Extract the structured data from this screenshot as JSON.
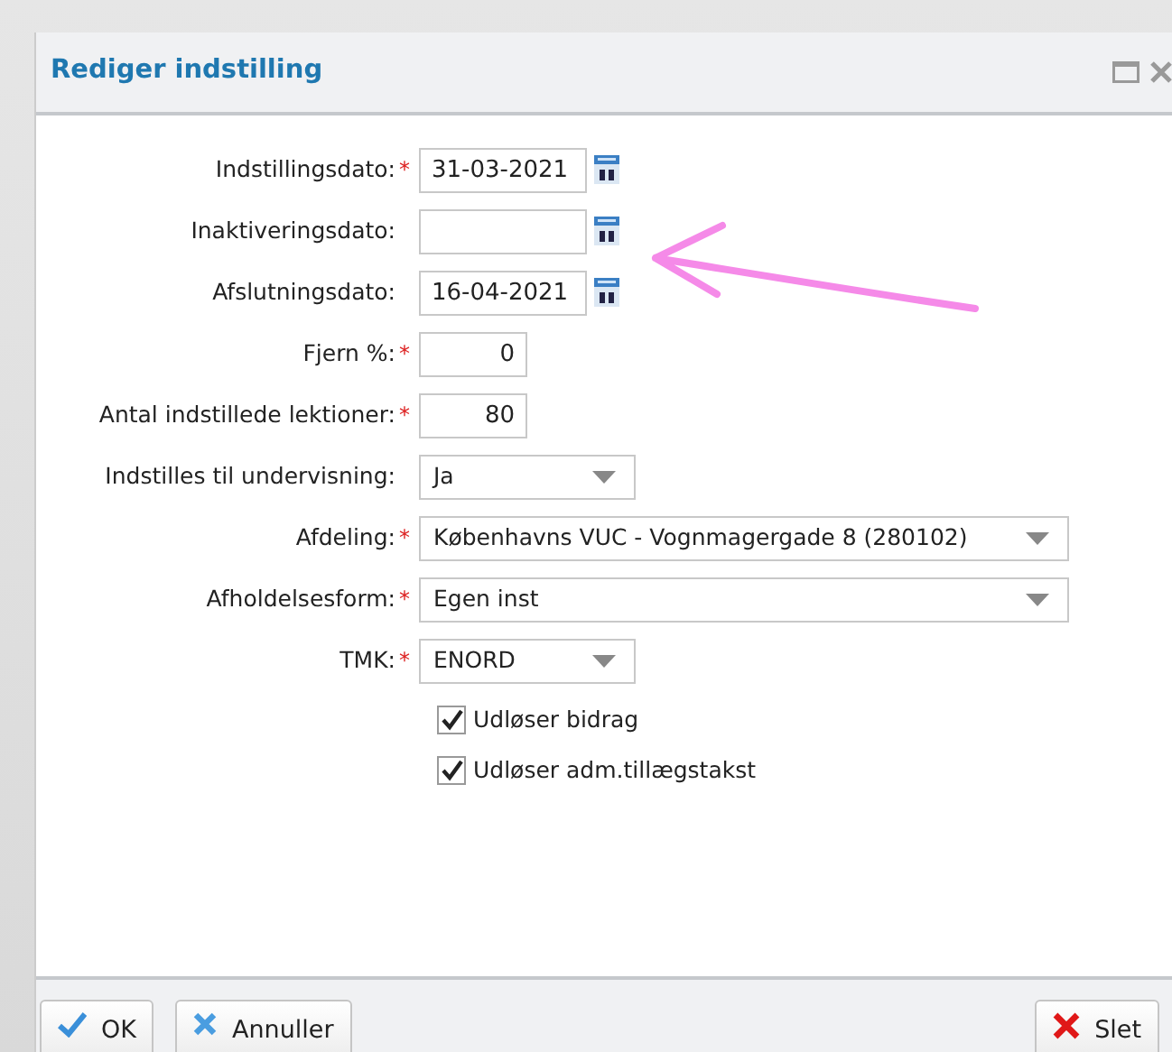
{
  "window": {
    "title": "Rediger indstilling"
  },
  "required_mark": "*",
  "fields": [
    {
      "label": "Indstillingsdato:",
      "required": true,
      "kind": "date",
      "value": "31-03-2021"
    },
    {
      "label": "Inaktiveringsdato:",
      "required": false,
      "kind": "date"
    },
    {
      "label": "Afslutningsdato:",
      "required": false,
      "kind": "date",
      "value": "16-04-2021"
    },
    {
      "label": "Fjern %:",
      "required": true,
      "kind": "number",
      "value": "0"
    },
    {
      "label": "Antal indstillede lektioner:",
      "required": true,
      "kind": "number",
      "value": "80"
    },
    {
      "label": "Indstilles til undervisning:",
      "required": false,
      "kind": "select",
      "value": "Ja"
    },
    {
      "label": "Afdeling:",
      "required": true,
      "kind": "select-wide",
      "value": "Københavns VUC - Vognmagergade 8 (280102)"
    },
    {
      "label": "Afholdelsesform:",
      "required": true,
      "kind": "select-wide",
      "value": "Egen inst"
    },
    {
      "label": "TMK:",
      "required": true,
      "kind": "select",
      "value": "ENORD"
    }
  ],
  "checkboxes": [
    {
      "label": "Udløser bidrag",
      "checked": true
    },
    {
      "label": "Udløser adm.tillægstakst",
      "checked": true
    }
  ],
  "buttons": [
    {
      "label": "OK",
      "kind": "ok"
    },
    {
      "label": "Annuller",
      "kind": "cancel"
    },
    {
      "label": "Slet",
      "kind": "delete"
    }
  ]
}
